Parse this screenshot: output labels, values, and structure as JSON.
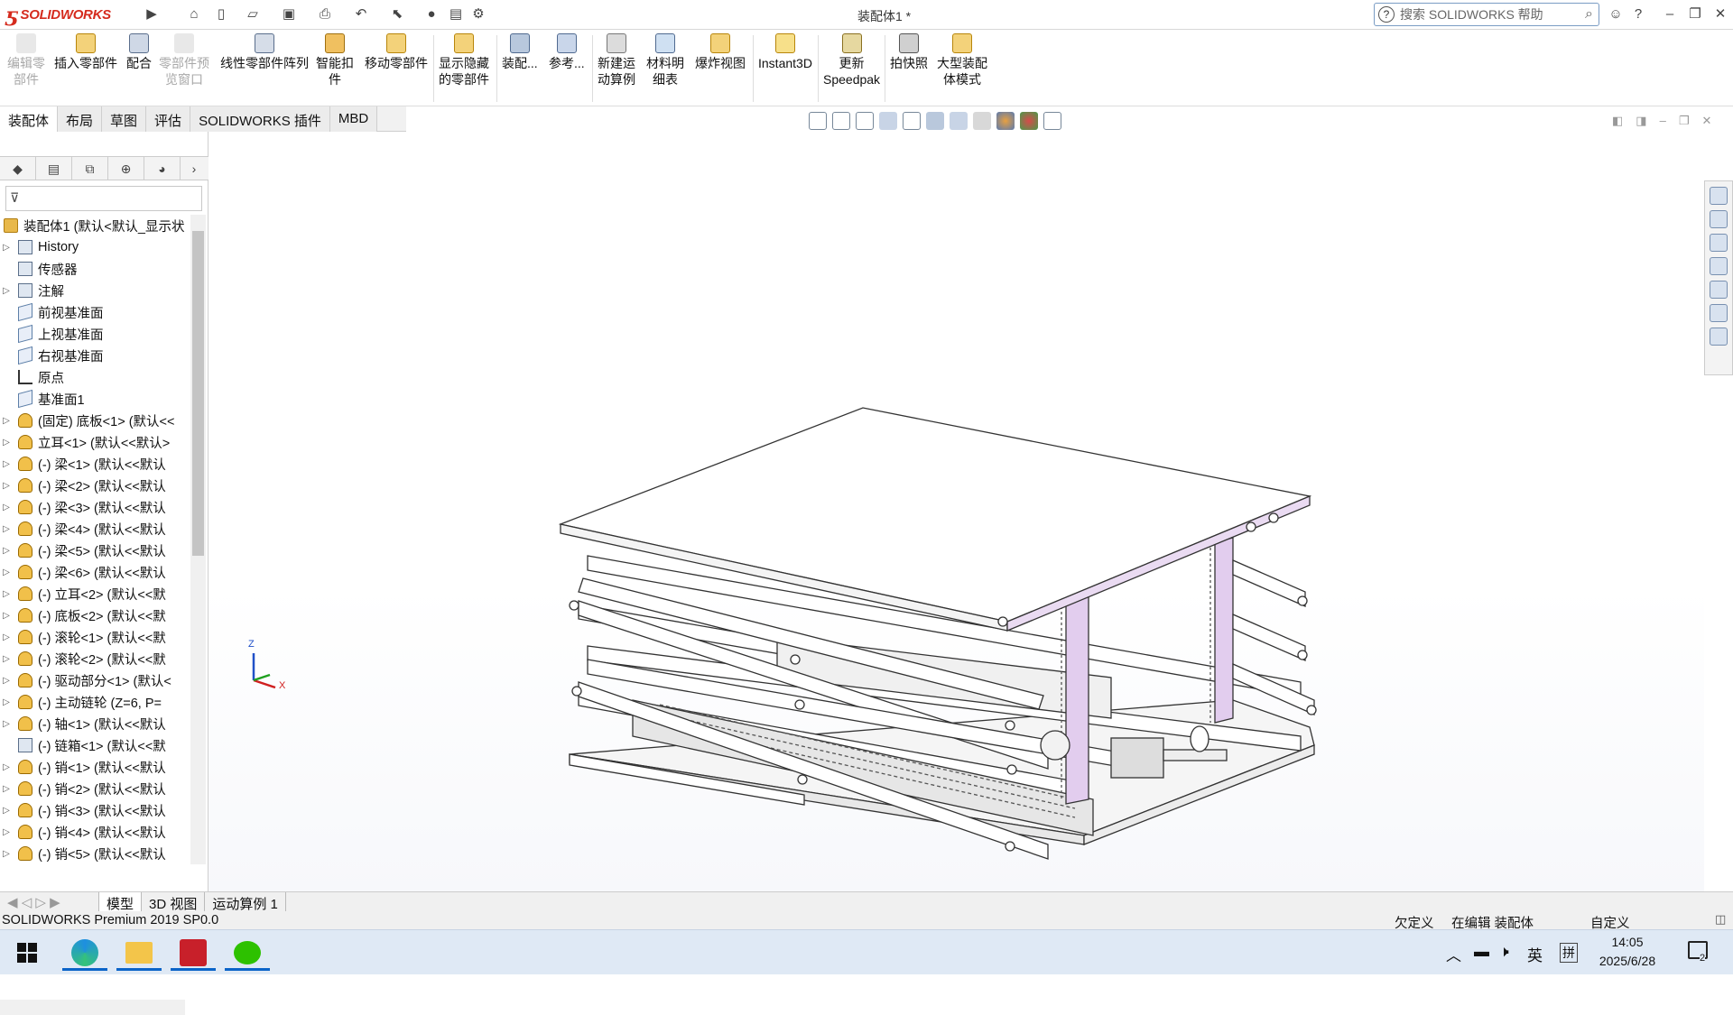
{
  "app": {
    "brand": "SOLIDWORKS",
    "document_title": "装配体1 *"
  },
  "search": {
    "placeholder": "搜索 SOLIDWORKS 帮助"
  },
  "ribbon": [
    {
      "label": "编辑零\n部件",
      "enabled": false
    },
    {
      "label": "插入零部件",
      "enabled": true
    },
    {
      "label": "配合",
      "enabled": true
    },
    {
      "label": "零部件预\n览窗口",
      "enabled": false
    },
    {
      "label": "线性零部件阵列",
      "enabled": true
    },
    {
      "label": "智能扣\n件",
      "enabled": true
    },
    {
      "label": "移动零部件",
      "enabled": true
    },
    {
      "label": "显示隐藏\n的零部件",
      "enabled": true
    },
    {
      "label": "装配...",
      "enabled": true
    },
    {
      "label": "参考...",
      "enabled": true
    },
    {
      "label": "新建运\n动算例",
      "enabled": true
    },
    {
      "label": "材料明\n细表",
      "enabled": true
    },
    {
      "label": "爆炸视图",
      "enabled": true
    },
    {
      "label": "Instant3D",
      "enabled": true
    },
    {
      "label": "更新\nSpeedpak",
      "enabled": true
    },
    {
      "label": "拍快照",
      "enabled": true
    },
    {
      "label": "大型装配\n体模式",
      "enabled": true
    }
  ],
  "command_tabs": [
    "装配体",
    "布局",
    "草图",
    "评估",
    "SOLIDWORKS 插件",
    "MBD"
  ],
  "tree": {
    "root": "装配体1 (默认<默认_显示状",
    "items": [
      {
        "label": "History",
        "icon": "history-folder",
        "expand": true
      },
      {
        "label": "传感器",
        "icon": "sensor-folder",
        "expand": false
      },
      {
        "label": "注解",
        "icon": "annotation-folder",
        "expand": true
      },
      {
        "label": "前视基准面",
        "icon": "plane",
        "expand": false
      },
      {
        "label": "上视基准面",
        "icon": "plane",
        "expand": false
      },
      {
        "label": "右视基准面",
        "icon": "plane",
        "expand": false
      },
      {
        "label": "原点",
        "icon": "origin",
        "expand": false
      },
      {
        "label": "基准面1",
        "icon": "plane",
        "expand": false
      },
      {
        "label": "(固定) 底板<1> (默认<<",
        "icon": "part",
        "expand": true
      },
      {
        "label": "立耳<1> (默认<<默认>",
        "icon": "part",
        "expand": true
      },
      {
        "label": "(-) 梁<1> (默认<<默认",
        "icon": "part",
        "expand": true
      },
      {
        "label": "(-) 梁<2> (默认<<默认",
        "icon": "part",
        "expand": true
      },
      {
        "label": "(-) 梁<3> (默认<<默认",
        "icon": "part",
        "expand": true
      },
      {
        "label": "(-) 梁<4> (默认<<默认",
        "icon": "part",
        "expand": true
      },
      {
        "label": "(-) 梁<5> (默认<<默认",
        "icon": "part",
        "expand": true
      },
      {
        "label": "(-) 梁<6> (默认<<默认",
        "icon": "part",
        "expand": true
      },
      {
        "label": "(-) 立耳<2> (默认<<默",
        "icon": "part",
        "expand": true
      },
      {
        "label": "(-) 底板<2> (默认<<默",
        "icon": "part",
        "expand": true
      },
      {
        "label": "(-) 滚轮<1> (默认<<默",
        "icon": "part",
        "expand": true
      },
      {
        "label": "(-) 滚轮<2> (默认<<默",
        "icon": "part",
        "expand": true
      },
      {
        "label": "(-) 驱动部分<1> (默认<",
        "icon": "part",
        "expand": true
      },
      {
        "label": "(-) 主动链轮 (Z=6, P=",
        "icon": "part",
        "expand": true
      },
      {
        "label": "(-) 轴<1> (默认<<默认",
        "icon": "part",
        "expand": true
      },
      {
        "label": "(-) 链箱<1> (默认<<默",
        "icon": "chain",
        "expand": false
      },
      {
        "label": "(-) 销<1> (默认<<默认",
        "icon": "part",
        "expand": true
      },
      {
        "label": "(-) 销<2> (默认<<默认",
        "icon": "part",
        "expand": true
      },
      {
        "label": "(-) 销<3> (默认<<默认",
        "icon": "part",
        "expand": true
      },
      {
        "label": "(-) 销<4> (默认<<默认",
        "icon": "part",
        "expand": true
      },
      {
        "label": "(-) 销<5> (默认<<默认",
        "icon": "part",
        "expand": true
      }
    ]
  },
  "bottom_tabs": [
    "模型",
    "3D 视图",
    "运动算例 1"
  ],
  "status": {
    "product": "SOLIDWORKS Premium 2019 SP0.0",
    "defined": "欠定义",
    "mode": "在编辑 装配体",
    "units": "自定义"
  },
  "taskbar": {
    "time": "14:05",
    "date": "2025/6/28",
    "ime_lang": "英",
    "ime_mode": "拼",
    "notifications": "2"
  },
  "triad": {
    "z": "Z",
    "x": "X"
  },
  "colors": {
    "brand": "#d52b1e",
    "model_accent": "#d9c6e6",
    "taskbar": "#dfe9f5"
  }
}
